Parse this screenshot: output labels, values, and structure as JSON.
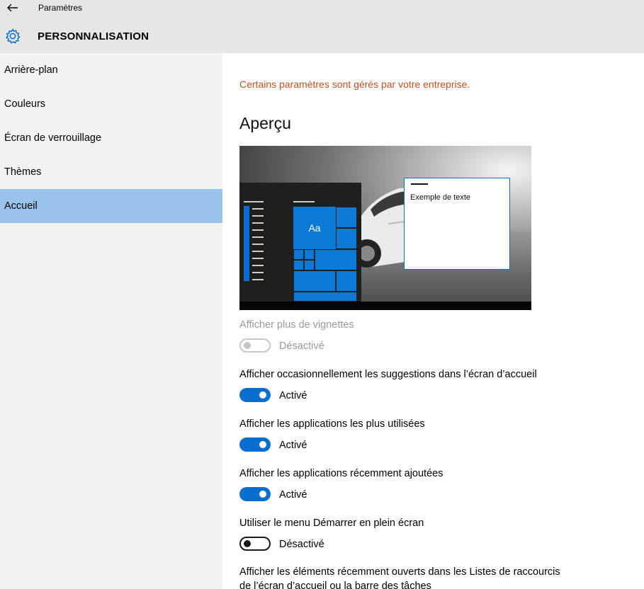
{
  "window": {
    "title": "Paramètres"
  },
  "header": {
    "section": "PERSONNALISATION"
  },
  "sidebar": {
    "items": [
      {
        "label": "Arrière-plan"
      },
      {
        "label": "Couleurs"
      },
      {
        "label": "Écran de verrouillage"
      },
      {
        "label": "Thèmes"
      },
      {
        "label": "Accueil"
      }
    ],
    "selected": "Accueil"
  },
  "content": {
    "policy_notice": "Certains paramètres sont gérés par votre entreprise.",
    "preview_heading": "Aperçu",
    "preview": {
      "tile_label": "Aa",
      "sample_text": "Exemple de texte"
    },
    "settings": [
      {
        "label": "Afficher plus de vignettes",
        "state": "Désactivé",
        "on": false,
        "disabled": true
      },
      {
        "label": "Afficher occasionnellement les suggestions dans l’écran d’accueil",
        "state": "Activé",
        "on": true,
        "disabled": false
      },
      {
        "label": "Afficher les applications les plus utilisées",
        "state": "Activé",
        "on": true,
        "disabled": false
      },
      {
        "label": "Afficher les applications récemment ajoutées",
        "state": "Activé",
        "on": true,
        "disabled": false
      },
      {
        "label": "Utiliser le menu Démarrer en plein écran",
        "state": "Désactivé",
        "on": false,
        "disabled": false
      },
      {
        "label": "Afficher les éléments récemment ouverts dans les Listes de raccourcis de l’écran d’accueil ou la barre des tâches"
      }
    ]
  },
  "colors": {
    "accent": "#0a6ed1",
    "selection": "#99c3ea",
    "warning": "#c84f1e",
    "sidebar_bg": "#f2f2f2",
    "header_bg": "#e6e6e6"
  },
  "icons": {
    "back": "back-arrow-icon",
    "settings": "gear-icon"
  }
}
